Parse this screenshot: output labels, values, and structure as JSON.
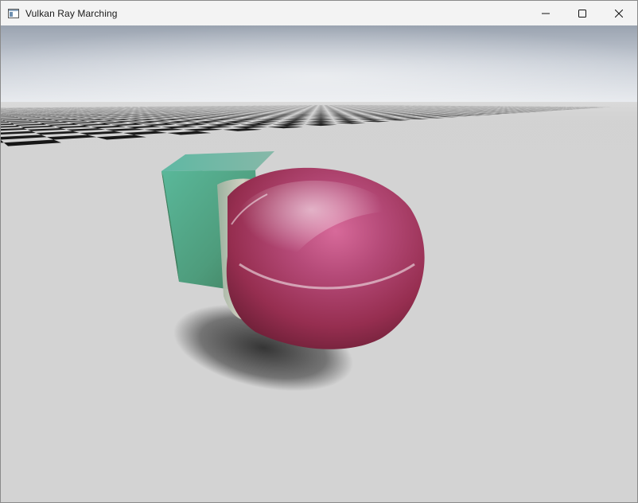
{
  "window": {
    "title": "Vulkan Ray Marching",
    "icon": "app-window-icon",
    "controls": [
      {
        "name": "minimize-button",
        "icon": "minimize-icon"
      },
      {
        "name": "maximize-button",
        "icon": "maximize-icon"
      },
      {
        "name": "close-button",
        "icon": "close-icon"
      }
    ]
  },
  "scene": {
    "description_icon": "ray-marched-scene",
    "colors": {
      "sky_top": "#8e98a6",
      "sky_horizon": "#e2e6ec",
      "checker_light": "#d3d3d3",
      "checker_dark": "#000000",
      "cube": "#5fae8e",
      "blob": "#9e2f55"
    }
  }
}
